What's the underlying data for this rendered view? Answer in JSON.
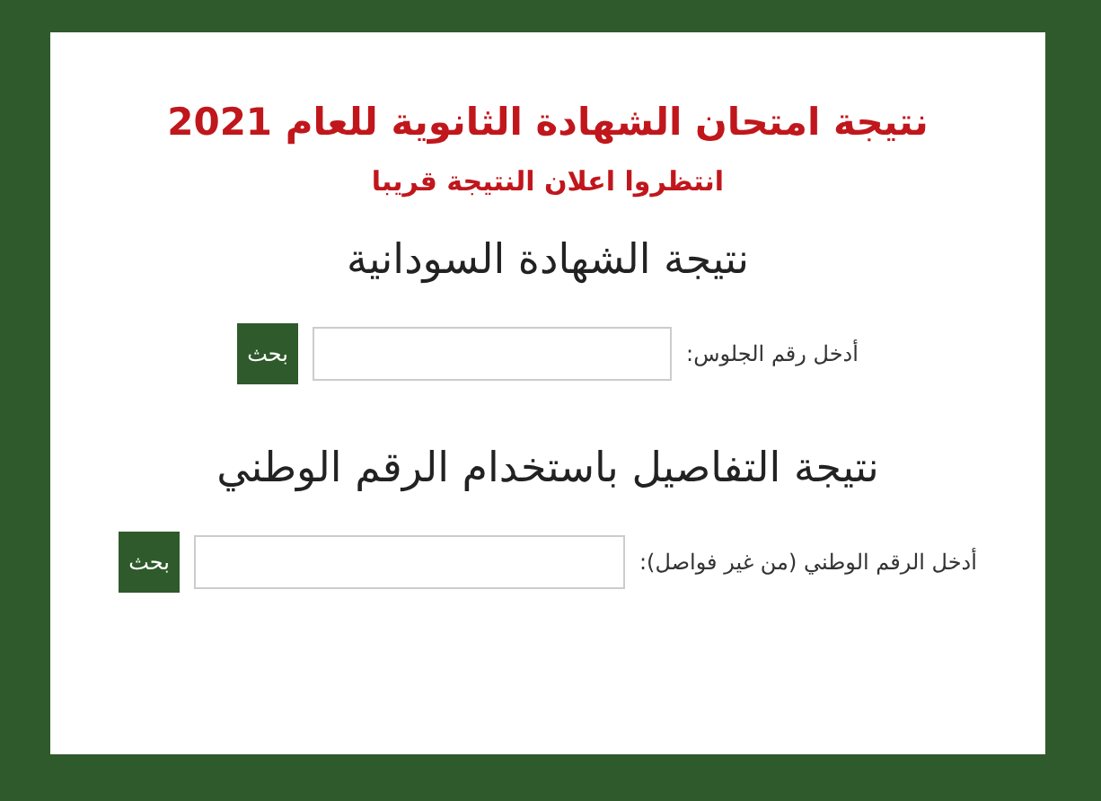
{
  "title": "نتيجة امتحان الشهادة الثانوية للعام 2021",
  "subtitle": "انتظروا اعلان النتيجة قريبا",
  "sections": [
    {
      "heading": "نتيجة الشهادة السودانية",
      "label": "أدخل رقم الجلوس:",
      "button": "بحث"
    },
    {
      "heading": "نتيجة التفاصيل باستخدام الرقم الوطني",
      "label": "أدخل الرقم الوطني (من غير فواصل):",
      "button": "بحث"
    }
  ]
}
